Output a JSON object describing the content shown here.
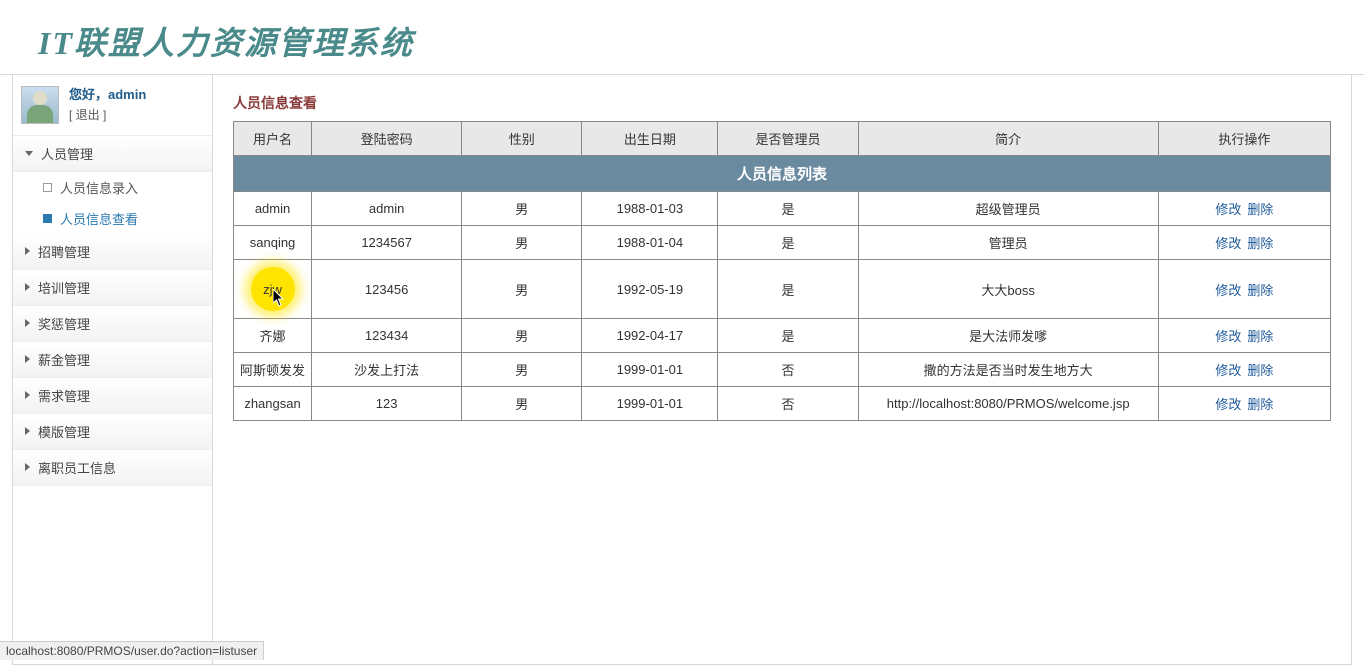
{
  "app_title": "IT联盟人力资源管理系统",
  "user": {
    "greeting": "您好，admin",
    "logout": "[ 退出 ]"
  },
  "menu": [
    {
      "label": "人员管理",
      "expanded": true,
      "children": [
        {
          "label": "人员信息录入",
          "active": false
        },
        {
          "label": "人员信息查看",
          "active": true
        }
      ]
    },
    {
      "label": "招聘管理",
      "expanded": false
    },
    {
      "label": "培训管理",
      "expanded": false
    },
    {
      "label": "奖惩管理",
      "expanded": false
    },
    {
      "label": "薪金管理",
      "expanded": false
    },
    {
      "label": "需求管理",
      "expanded": false
    },
    {
      "label": "模版管理",
      "expanded": false
    },
    {
      "label": "离职员工信息",
      "expanded": false
    }
  ],
  "page": {
    "heading": "人员信息查看",
    "table_title": "人员信息列表",
    "columns": [
      "用户名",
      "登陆密码",
      "性别",
      "出生日期",
      "是否管理员",
      "简介",
      "执行操作"
    ],
    "actions": {
      "edit": "修改",
      "delete": "删除"
    },
    "rows": [
      {
        "user": "admin",
        "pwd": "admin",
        "sex": "男",
        "birth": "1988-01-03",
        "admin": "是",
        "intro": "超级管理员"
      },
      {
        "user": "sanqing",
        "pwd": "1234567",
        "sex": "男",
        "birth": "1988-01-04",
        "admin": "是",
        "intro": "管理员"
      },
      {
        "user": "zjw",
        "pwd": "123456",
        "sex": "男",
        "birth": "1992-05-19",
        "admin": "是",
        "intro": "大大boss",
        "highlight": true
      },
      {
        "user": "齐娜",
        "pwd": "123434",
        "sex": "男",
        "birth": "1992-04-17",
        "admin": "是",
        "intro": "是大法师发嗲"
      },
      {
        "user": "阿斯顿发发",
        "pwd": "沙发上打法",
        "sex": "男",
        "birth": "1999-01-01",
        "admin": "否",
        "intro": "撒的方法是否当时发生地方大"
      },
      {
        "user": "zhangsan",
        "pwd": "123",
        "sex": "男",
        "birth": "1999-01-01",
        "admin": "否",
        "intro": "http://localhost:8080/PRMOS/welcome.jsp"
      }
    ]
  },
  "status_text": "localhost:8080/PRMOS/user.do?action=listuser"
}
